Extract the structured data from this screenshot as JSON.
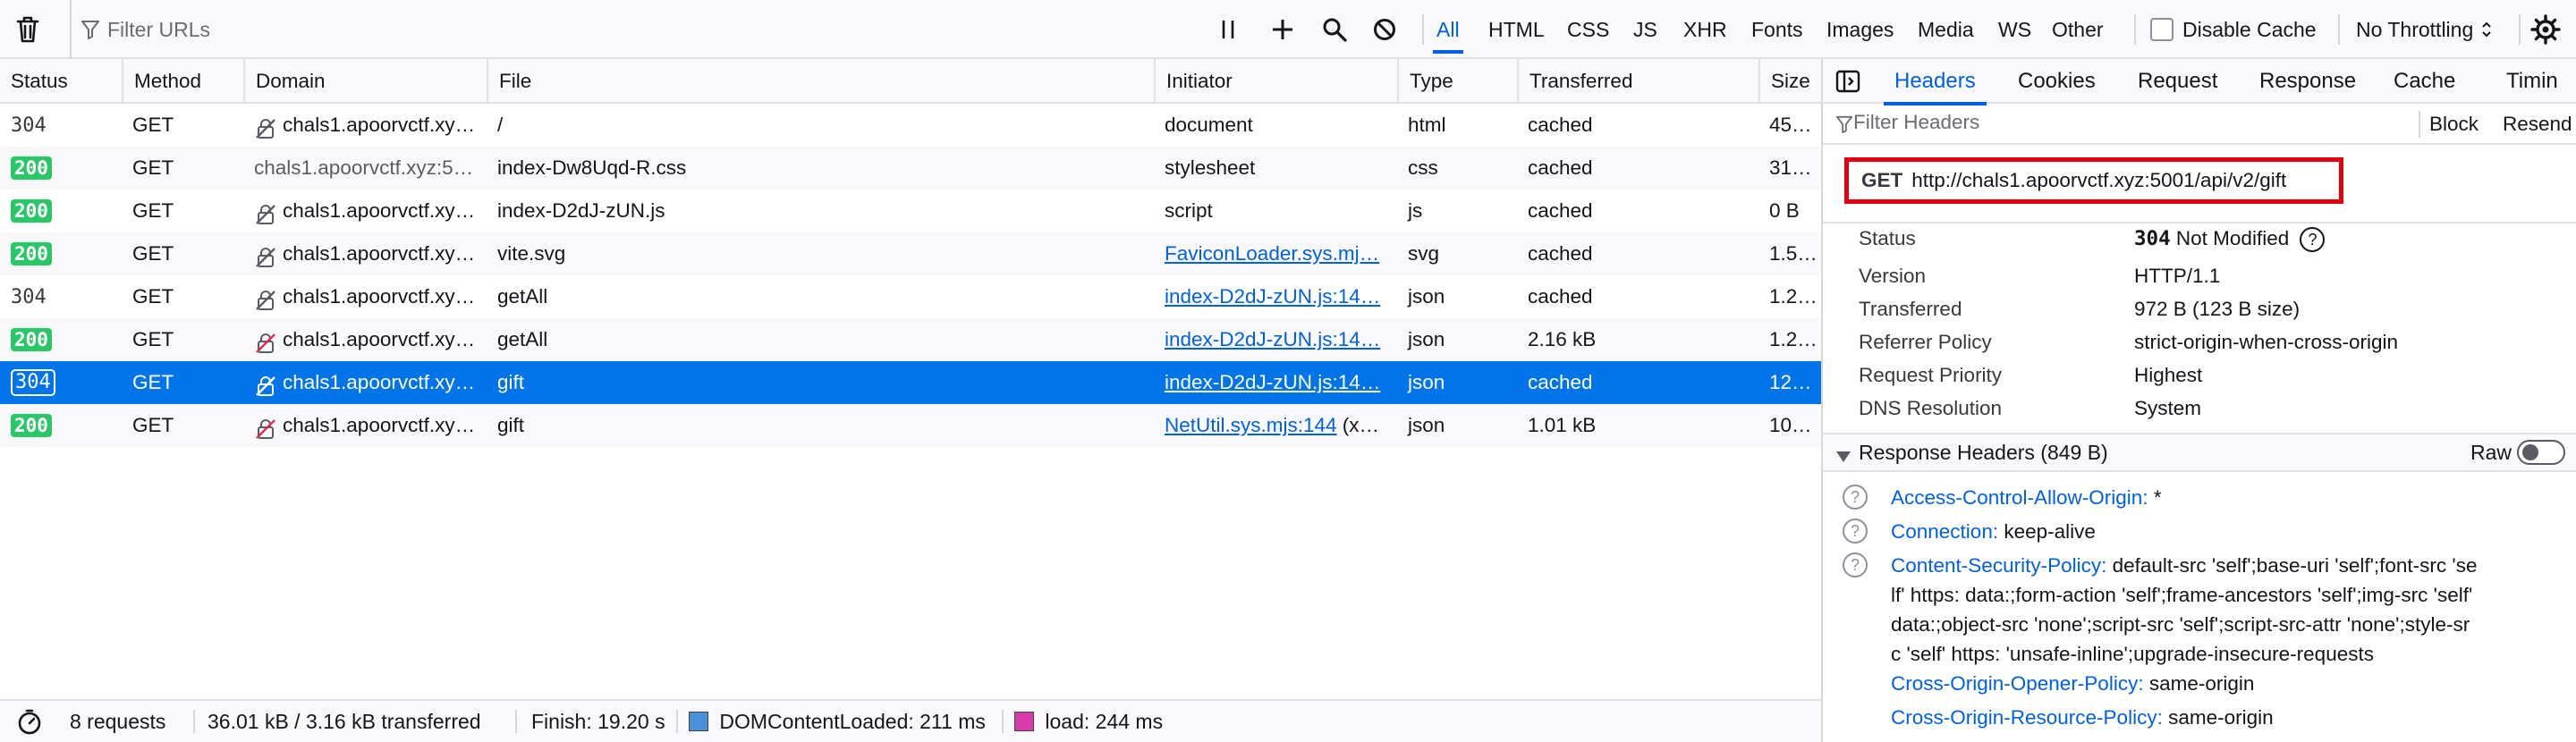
{
  "toolbar": {
    "filter_placeholder": "Filter URLs",
    "type_filters": [
      "All",
      "HTML",
      "CSS",
      "JS",
      "XHR",
      "Fonts",
      "Images",
      "Media",
      "WS",
      "Other"
    ],
    "active_filter": "All",
    "disable_cache_label": "Disable Cache",
    "disable_cache_checked": false,
    "throttling_label": "No Throttling"
  },
  "table": {
    "columns": [
      "Status",
      "Method",
      "Domain",
      "File",
      "Initiator",
      "Type",
      "Transferred",
      "Size"
    ],
    "rows": [
      {
        "status": "304",
        "method": "GET",
        "domain": "chals1.apoorvctf.xy…",
        "domain_icon": "insecure-lock",
        "file": "/",
        "initiator": "document",
        "initiator_link": false,
        "type": "html",
        "transferred": "cached",
        "size": "45…"
      },
      {
        "status": "200",
        "method": "GET",
        "domain": "chals1.apoorvctf.xyz:5…",
        "domain_icon": "",
        "file": "index-Dw8Uqd-R.css",
        "initiator": "stylesheet",
        "initiator_link": false,
        "type": "css",
        "transferred": "cached",
        "size": "31…"
      },
      {
        "status": "200",
        "method": "GET",
        "domain": "chals1.apoorvctf.xy…",
        "domain_icon": "insecure-lock",
        "file": "index-D2dJ-zUN.js",
        "initiator": "script",
        "initiator_link": false,
        "type": "js",
        "transferred": "cached",
        "size": "0 B"
      },
      {
        "status": "200",
        "method": "GET",
        "domain": "chals1.apoorvctf.xy…",
        "domain_icon": "insecure-lock",
        "file": "vite.svg",
        "initiator": "FaviconLoader.sys.mj…",
        "initiator_link": true,
        "type": "svg",
        "transferred": "cached",
        "size": "1.5…"
      },
      {
        "status": "304",
        "method": "GET",
        "domain": "chals1.apoorvctf.xy…",
        "domain_icon": "insecure-lock",
        "file": "getAll",
        "initiator": "index-D2dJ-zUN.js:14…",
        "initiator_link": true,
        "type": "json",
        "transferred": "cached",
        "size": "1.2…"
      },
      {
        "status": "200",
        "method": "GET",
        "domain": "chals1.apoorvctf.xy…",
        "domain_icon": "insecure-lock-red",
        "file": "getAll",
        "initiator": "index-D2dJ-zUN.js:14…",
        "initiator_link": true,
        "type": "json",
        "transferred": "2.16 kB",
        "size": "1.2…"
      },
      {
        "status": "304",
        "method": "GET",
        "domain": "chals1.apoorvctf.xy…",
        "domain_icon": "insecure-lock",
        "file": "gift",
        "initiator": "index-D2dJ-zUN.js:14…",
        "initiator_link": true,
        "type": "json",
        "transferred": "cached",
        "size": "12…",
        "selected": true
      },
      {
        "status": "200",
        "method": "GET",
        "domain": "chals1.apoorvctf.xy…",
        "domain_icon": "insecure-lock-red",
        "file": "gift",
        "initiator": "NetUtil.sys.mjs:144",
        "initiator_suffix": " (x…",
        "initiator_link": true,
        "type": "json",
        "transferred": "1.01 kB",
        "size": "10…"
      }
    ]
  },
  "status_bar": {
    "requests": "8 requests",
    "transferred": "36.01 kB / 3.16 kB transferred",
    "finish": "Finish: 19.20 s",
    "dom_content_loaded": "DOMContentLoaded: 211 ms",
    "load": "load: 244 ms",
    "dcl_color": "#4a90d9",
    "load_color": "#d63aab"
  },
  "panel": {
    "tabs": [
      "Headers",
      "Cookies",
      "Request",
      "Response",
      "Cache",
      "Timin"
    ],
    "active_tab": "Headers",
    "filter_placeholder": "Filter Headers",
    "block_label": "Block",
    "resend_label": "Resend",
    "summary": {
      "method": "GET",
      "url": "http://chals1.apoorvctf.xyz:5001/api/v2/gift"
    },
    "info": [
      {
        "key": "Status",
        "value": "Not Modified",
        "code": "304"
      },
      {
        "key": "Version",
        "value": "HTTP/1.1"
      },
      {
        "key": "Transferred",
        "value": "972 B (123 B size)"
      },
      {
        "key": "Referrer Policy",
        "value": "strict-origin-when-cross-origin"
      },
      {
        "key": "Request Priority",
        "value": "Highest"
      },
      {
        "key": "DNS Resolution",
        "value": "System"
      }
    ],
    "response_headers_title": "Response Headers (849 B)",
    "raw_label": "Raw",
    "response_headers": [
      {
        "name": "Access-Control-Allow-Origin:",
        "value": "*"
      },
      {
        "name": "Connection:",
        "value": "keep-alive"
      },
      {
        "name": "Content-Security-Policy:",
        "value": "default-src 'self';base-uri 'self';font-src 'se",
        "continuation": [
          "lf' https: data:;form-action 'self';frame-ancestors 'self';img-src 'self'",
          "data:;object-src 'none';script-src 'self';script-src-attr 'none';style-sr",
          "c 'self' https: 'unsafe-inline';upgrade-insecure-requests"
        ]
      },
      {
        "name": "Cross-Origin-Opener-Policy:",
        "value": "same-origin"
      },
      {
        "name": "Cross-Origin-Resource-Policy:",
        "value": "same-origin"
      }
    ]
  }
}
